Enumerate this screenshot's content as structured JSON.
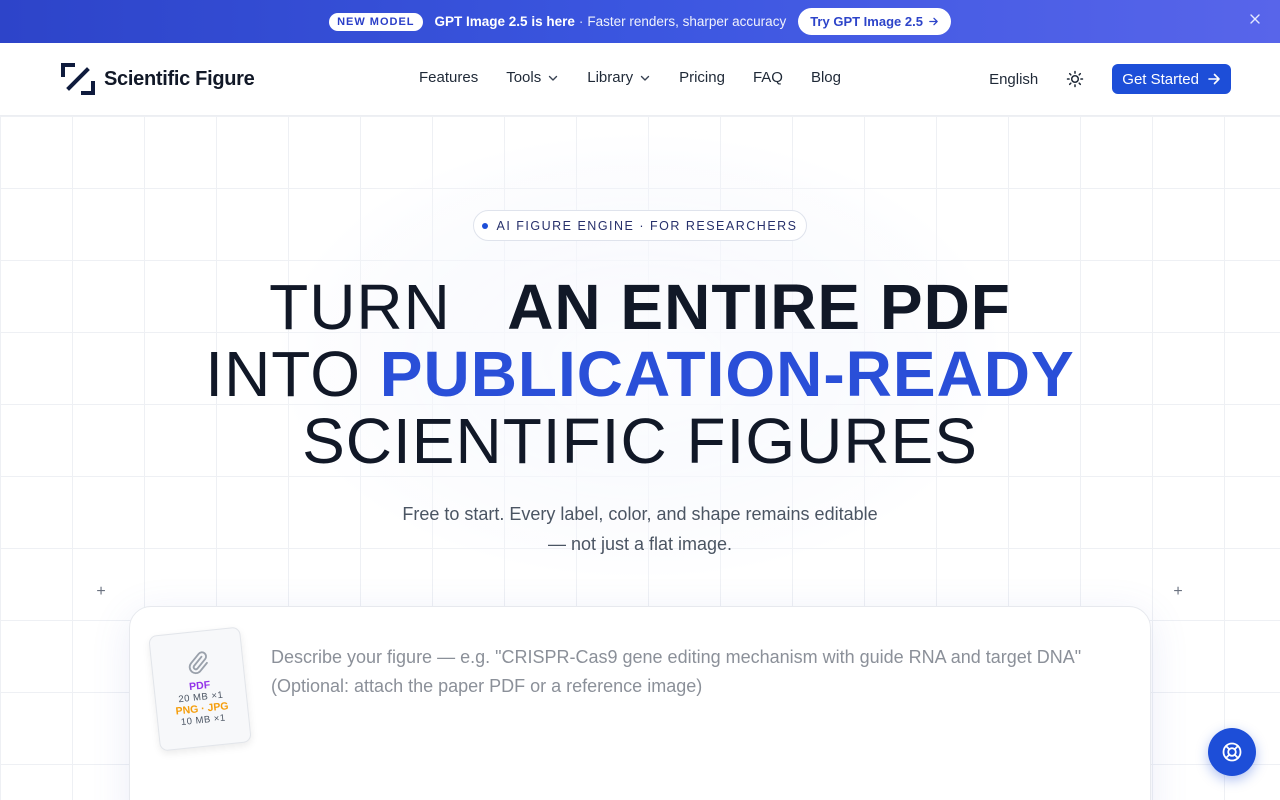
{
  "announcement": {
    "badge": "NEW MODEL",
    "headline": "GPT Image 2.5 is here",
    "separator": "·",
    "subtext": "Faster renders, sharper accuracy",
    "cta": "Try GPT Image 2.5",
    "cta_icon": "arrow-right-icon",
    "close_icon": "close-icon"
  },
  "nav": {
    "brand": "Scientific Figure",
    "links": [
      {
        "label": "Features",
        "dropdown": false
      },
      {
        "label": "Tools",
        "dropdown": true
      },
      {
        "label": "Library",
        "dropdown": true
      },
      {
        "label": "Pricing",
        "dropdown": false
      },
      {
        "label": "FAQ",
        "dropdown": false
      },
      {
        "label": "Blog",
        "dropdown": false
      }
    ],
    "language": "English",
    "theme_icon": "sun-icon",
    "cta": "Get Started"
  },
  "hero": {
    "tag": "AI FIGURE ENGINE · FOR RESEARCHERS",
    "line1_light": "TURN",
    "line1_bold": "AN ENTIRE PDF",
    "line2_light": "INTO",
    "line2_accent": "PUBLICATION-READY",
    "line3_light": "SCIENTIFIC FIGURES",
    "sub1": "Free to start. Every label, color, and shape remains editable",
    "sub2": "— not just a flat image."
  },
  "composer": {
    "attach": {
      "pdf": "PDF",
      "pdf_limit": "20 MB ×1",
      "img": "PNG · JPG",
      "img_limit": "10 MB ×1"
    },
    "placeholder": "Describe your figure — e.g. \"CRISPR-Cas9 gene editing mechanism with guide RNA and target DNA\"\n(Optional: attach the paper PDF or a reference image)"
  },
  "colors": {
    "brand_blue": "#1d4ed8",
    "accent_blue": "#2a4fd8",
    "pdf_purple": "#9333ea",
    "img_orange": "#f59e0b"
  },
  "help_icon": "lifebuoy-icon"
}
